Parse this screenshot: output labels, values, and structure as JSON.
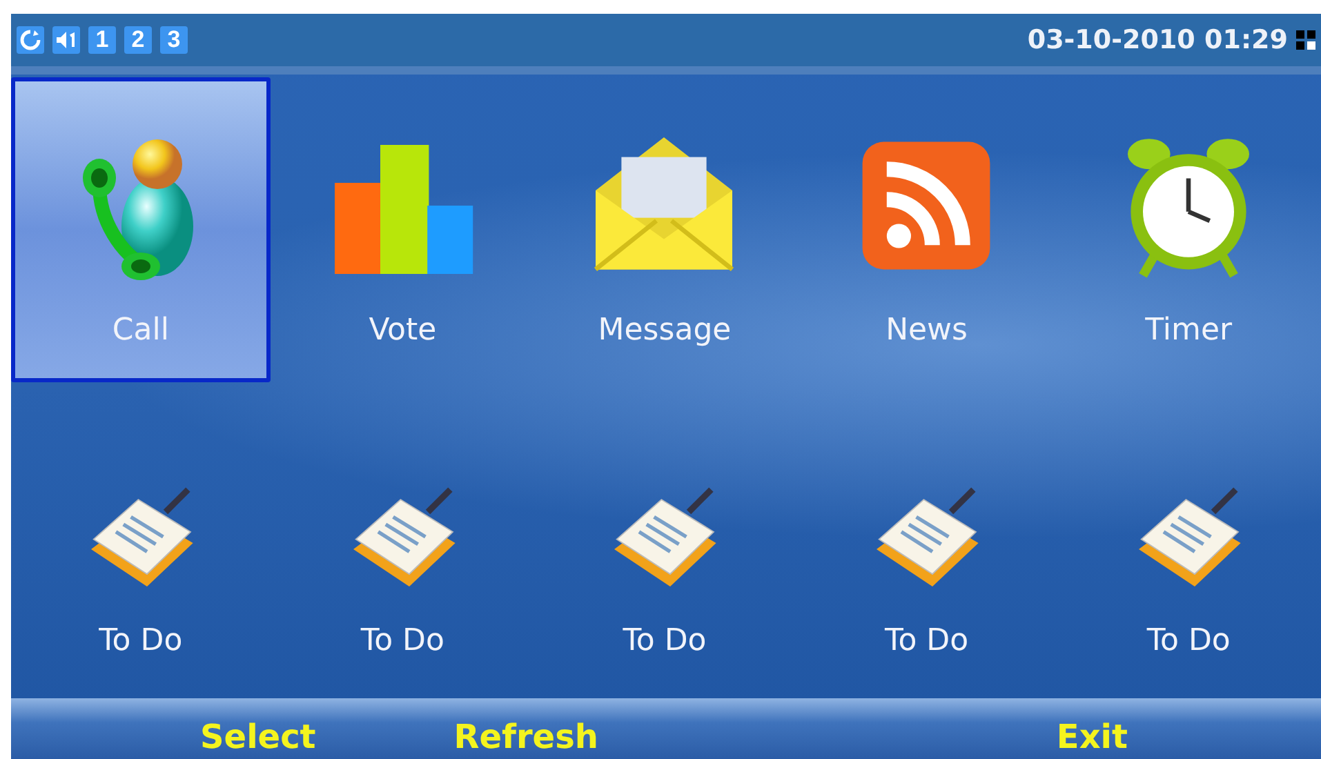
{
  "status_bar": {
    "indicators": [
      {
        "kind": "sync"
      },
      {
        "kind": "volume"
      },
      {
        "kind": "number",
        "label": "1"
      },
      {
        "kind": "number",
        "label": "2"
      },
      {
        "kind": "number",
        "label": "3"
      }
    ],
    "datetime": "03-10-2010 01:29"
  },
  "apps": [
    {
      "label": "Call",
      "kind": "call",
      "selected": true
    },
    {
      "label": "Vote",
      "kind": "vote",
      "selected": false
    },
    {
      "label": "Message",
      "kind": "message",
      "selected": false
    },
    {
      "label": "News",
      "kind": "news",
      "selected": false
    },
    {
      "label": "Timer",
      "kind": "timer",
      "selected": false
    },
    {
      "label": "To Do",
      "kind": "todo",
      "selected": false
    },
    {
      "label": "To Do",
      "kind": "todo",
      "selected": false
    },
    {
      "label": "To Do",
      "kind": "todo",
      "selected": false
    },
    {
      "label": "To Do",
      "kind": "todo",
      "selected": false
    },
    {
      "label": "To Do",
      "kind": "todo",
      "selected": false
    }
  ],
  "softkeys": {
    "left": "Select",
    "center": "Refresh",
    "right": "Exit"
  }
}
